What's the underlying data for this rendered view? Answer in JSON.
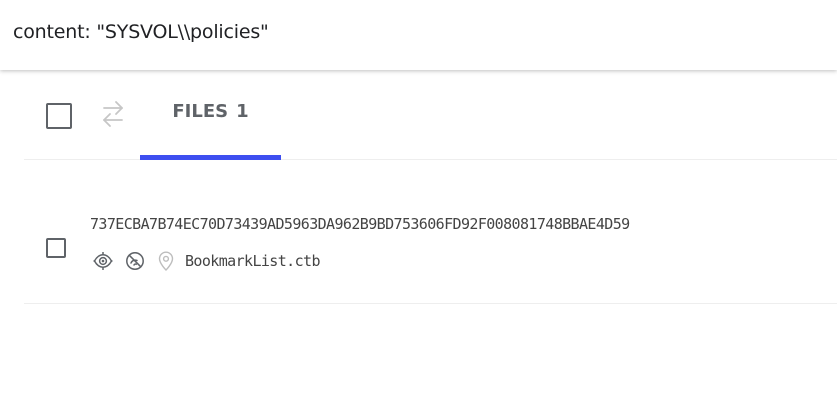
{
  "search": {
    "query": "content: \"SYSVOL\\\\policies\""
  },
  "toolbar": {
    "tab_files_label": "FILES",
    "tab_files_count": "1"
  },
  "results": [
    {
      "hash": "737ECBA7B74EC70D73439AD5963DA962B9BD753606FD92F008081748BBAE4D59",
      "file_name": "BookmarkList.ctb",
      "icons": [
        "eye-target-icon",
        "no-signal-globe-icon",
        "location-pin-icon"
      ]
    }
  ],
  "colors": {
    "accent": "#3d4ef0",
    "icon": "#5f6368",
    "icon_light": "#bdbdbd",
    "text": "#444444"
  }
}
